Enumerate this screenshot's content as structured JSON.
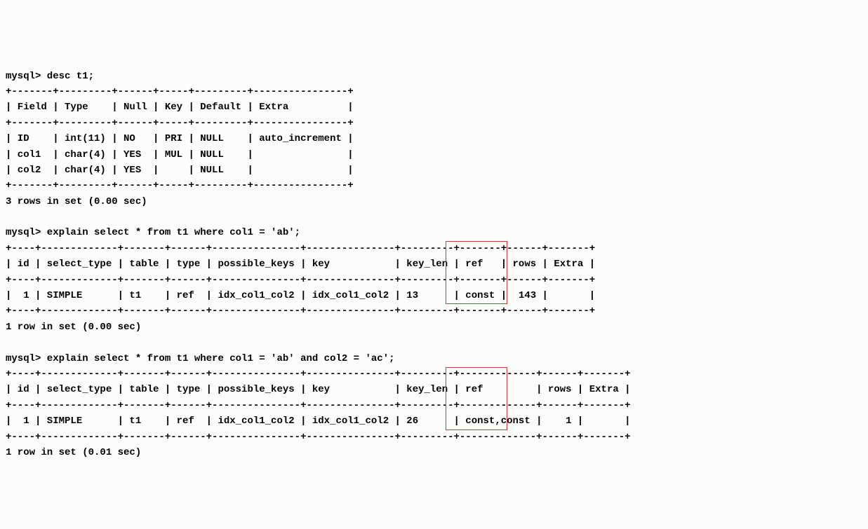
{
  "prompt1": "mysql> desc t1;",
  "desc_table": {
    "border_top": "+-------+---------+------+-----+---------+----------------+",
    "header": "| Field | Type    | Null | Key | Default | Extra          |",
    "border_mid": "+-------+---------+------+-----+---------+----------------+",
    "rows": [
      "| ID    | int(11) | NO   | PRI | NULL    | auto_increment |",
      "| col1  | char(4) | YES  | MUL | NULL    |                |",
      "| col2  | char(4) | YES  |     | NULL    |                |"
    ],
    "border_bot": "+-------+---------+------+-----+---------+----------------+",
    "summary": "3 rows in set (0.00 sec)"
  },
  "prompt2": "mysql> explain select * from t1 where col1 = 'ab';",
  "explain1": {
    "border_top": "+----+-------------+-------+------+---------------+---------------+---------+-------+------+-------+",
    "header": "| id | select_type | table | type | possible_keys | key           | key_len | ref   | rows | Extra |",
    "border_mid": "+----+-------------+-------+------+---------------+---------------+---------+-------+------+-------+",
    "rows": [
      "|  1 | SIMPLE      | t1    | ref  | idx_col1_col2 | idx_col1_col2 | 13      | const |  143 |       |"
    ],
    "border_bot": "+----+-------------+-------+------+---------------+---------------+---------+-------+------+-------+",
    "summary": "1 row in set (0.00 sec)"
  },
  "prompt3": "mysql> explain select * from t1 where col1 = 'ab' and col2 = 'ac';",
  "explain2": {
    "border_top": "+----+-------------+-------+------+---------------+---------------+---------+-------------+------+-------+",
    "header": "| id | select_type | table | type | possible_keys | key           | key_len | ref         | rows | Extra |",
    "border_mid": "+----+-------------+-------+------+---------------+---------------+---------+-------------+------+-------+",
    "rows": [
      "|  1 | SIMPLE      | t1    | ref  | idx_col1_col2 | idx_col1_col2 | 26      | const,const |    1 |       |"
    ],
    "border_bot": "+----+-------------+-------+------+---------------+---------------+---------+-------------+------+-------+",
    "summary": "1 row in set (0.01 sec)"
  },
  "chart_data": {
    "desc": {
      "type": "table",
      "columns": [
        "Field",
        "Type",
        "Null",
        "Key",
        "Default",
        "Extra"
      ],
      "rows": [
        [
          "ID",
          "int(11)",
          "NO",
          "PRI",
          "NULL",
          "auto_increment"
        ],
        [
          "col1",
          "char(4)",
          "YES",
          "MUL",
          "NULL",
          ""
        ],
        [
          "col2",
          "char(4)",
          "YES",
          "",
          "NULL",
          ""
        ]
      ]
    },
    "explain1": {
      "type": "table",
      "columns": [
        "id",
        "select_type",
        "table",
        "type",
        "possible_keys",
        "key",
        "key_len",
        "ref",
        "rows",
        "Extra"
      ],
      "rows": [
        [
          1,
          "SIMPLE",
          "t1",
          "ref",
          "idx_col1_col2",
          "idx_col1_col2",
          13,
          "const",
          143,
          ""
        ]
      ]
    },
    "explain2": {
      "type": "table",
      "columns": [
        "id",
        "select_type",
        "table",
        "type",
        "possible_keys",
        "key",
        "key_len",
        "ref",
        "rows",
        "Extra"
      ],
      "rows": [
        [
          1,
          "SIMPLE",
          "t1",
          "ref",
          "idx_col1_col2",
          "idx_col1_col2",
          26,
          "const,const",
          1,
          ""
        ]
      ]
    }
  }
}
